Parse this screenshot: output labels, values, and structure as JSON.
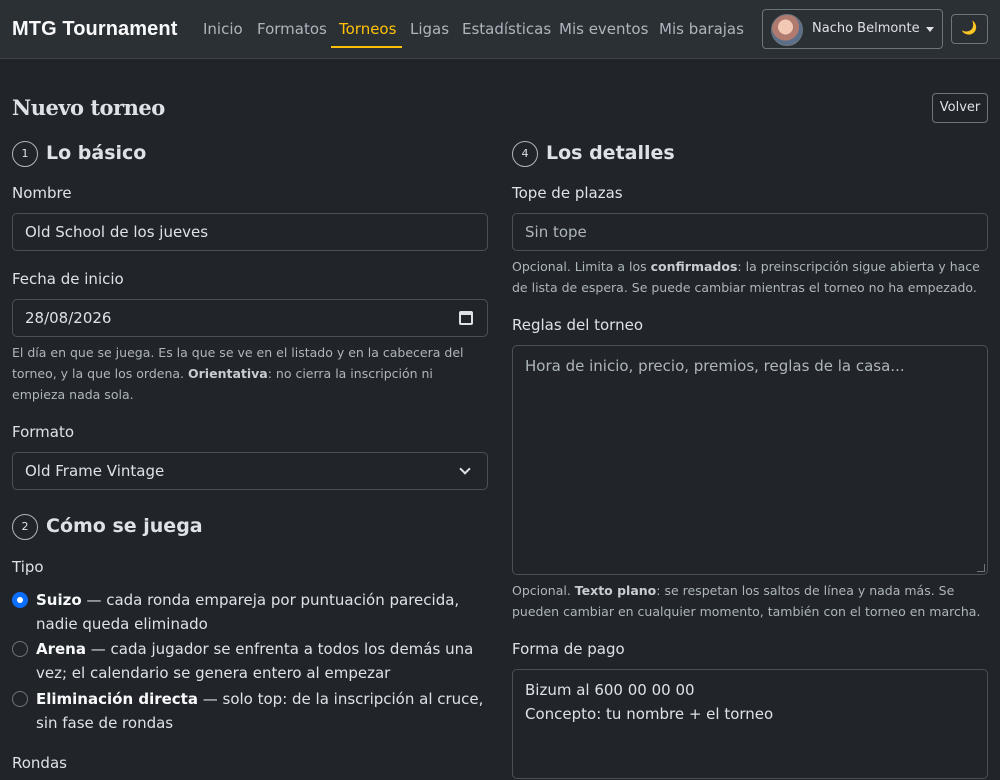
{
  "navbar": {
    "brand": "MTG Tournament",
    "links": [
      {
        "label": "Inicio"
      },
      {
        "label": "Formatos"
      },
      {
        "label": "Torneos",
        "active": true
      },
      {
        "label": "Ligas"
      },
      {
        "label": "Estadísticas"
      },
      {
        "label": "Mis eventos"
      },
      {
        "label": "Mis barajas"
      }
    ],
    "user_name": "Nacho Belmonte",
    "theme_icon": "🌙",
    "accent_color": "#ffc107"
  },
  "header": {
    "title": "Nuevo torneo",
    "back_label": "Volver"
  },
  "basics": {
    "step": "1",
    "title": "Lo básico",
    "name_label": "Nombre",
    "name_value": "Old School de los jueves",
    "date_label": "Fecha de inicio",
    "date_value": "28/08/2026",
    "date_help_1": "El día en que se juega. Es la que se ve en el listado y en la cabecera del torneo, y la que los ordena.",
    "date_help_bold": "Orientativa",
    "date_help_2": ": no cierra la inscripción ni empieza nada sola.",
    "format_label": "Formato",
    "format_value": "Old Frame Vintage"
  },
  "play": {
    "step": "2",
    "title": "Cómo se juega",
    "type_label": "Tipo",
    "options": [
      {
        "name": "Suizo",
        "desc": " — cada ronda empareja por puntuación parecida, nadie queda eliminado",
        "checked": true
      },
      {
        "name": "Arena",
        "desc": " — cada jugador se enfrenta a todos los demás una vez; el calendario se genera entero al empezar",
        "checked": false
      },
      {
        "name": "Eliminación directa",
        "desc": " — solo top: de la inscripción al cruce, sin fase de rondas",
        "checked": false
      }
    ],
    "rounds_label": "Rondas"
  },
  "details": {
    "step": "4",
    "title": "Los detalles",
    "cap_label": "Tope de plazas",
    "cap_placeholder": "Sin tope",
    "cap_help_1": "Opcional. Limita a los ",
    "cap_help_bold": "confirmados",
    "cap_help_2": ": la preinscripción sigue abierta y hace de lista de espera. Se puede cambiar mientras el torneo no ha empezado.",
    "rules_label": "Reglas del torneo",
    "rules_placeholder": "Hora de inicio, precio, premios, reglas de la casa...",
    "rules_help_1": "Opcional. ",
    "rules_help_bold": "Texto plano",
    "rules_help_2": ": se respetan los saltos de línea y nada más. Se pueden cambiar en cualquier momento, también con el torneo en marcha.",
    "payment_label": "Forma de pago",
    "payment_lines": [
      "Bizum al 600 00 00 00",
      "Concepto: tu nombre + el torneo"
    ]
  }
}
